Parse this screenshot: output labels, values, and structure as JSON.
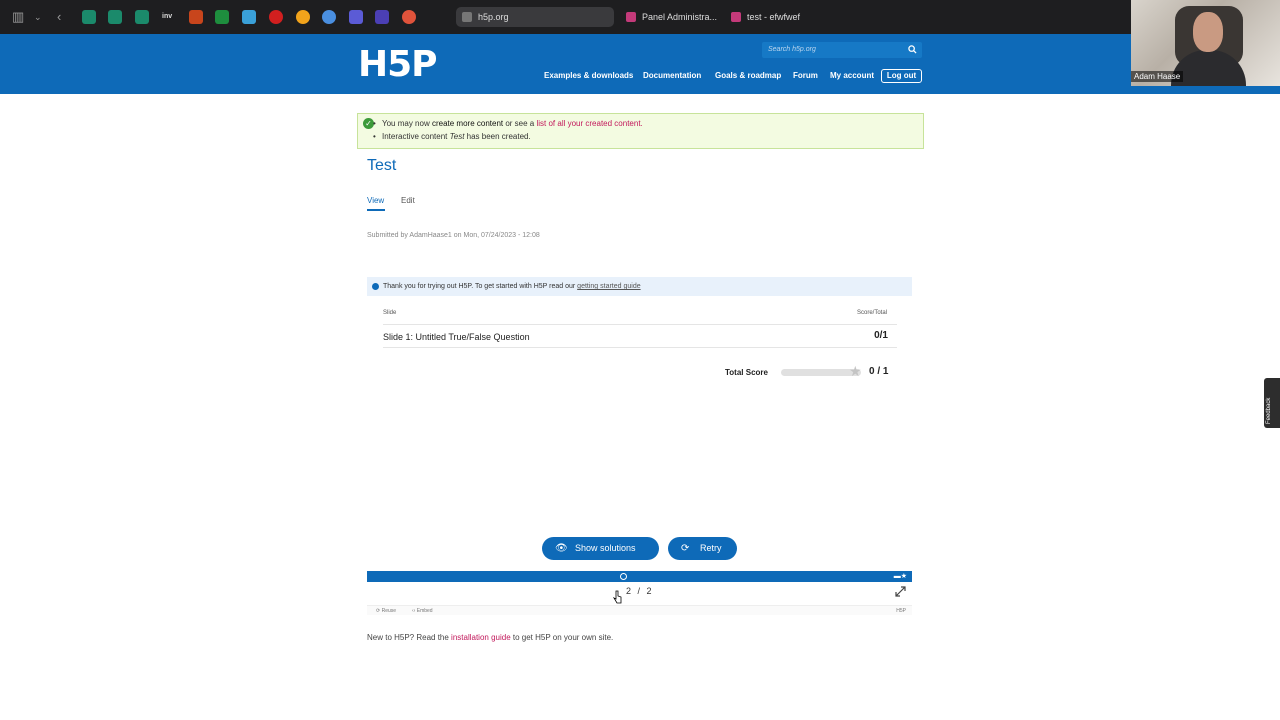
{
  "browser": {
    "tabs": [
      {
        "label": "h5p.org",
        "active": true
      },
      {
        "label": "Panel Administra...",
        "active": false
      },
      {
        "label": "test - efwfwef",
        "active": false
      }
    ],
    "bookmark_label_inv": "inv"
  },
  "header": {
    "logo": "H5P",
    "search_placeholder": "Search h5p.org",
    "nav": [
      "Examples & downloads",
      "Documentation",
      "Goals & roadmap",
      "Forum",
      "My account"
    ],
    "logout_label": "Log out"
  },
  "webcam": {
    "name": "Adam Haase"
  },
  "messages": {
    "line1_prefix": "You may now ",
    "line1_bold": "create more content",
    "line1_middle": " or see a ",
    "line1_link": "list of all your created content.",
    "line2_prefix": "Interactive content ",
    "line2_italic": "Test",
    "line2_suffix": " has been created."
  },
  "page": {
    "title": "Test",
    "tab_view": "View",
    "tab_edit": "Edit",
    "submitted": "Submitted by AdamHaase1 on Mon, 07/24/2023 - 12:08"
  },
  "h5p": {
    "info_text": "Thank you for trying out H5P. To get started with H5P read our ",
    "info_link": "getting started guide",
    "col_slide": "Slide",
    "col_score": "Score/Total",
    "rows": [
      {
        "slide": "Slide 1: Untitled True/False Question",
        "score": "0/1"
      }
    ],
    "total_label": "Total Score",
    "total_value": "0 / 1",
    "total_fraction": 0,
    "show_solutions": "Show solutions",
    "retry": "Retry",
    "pager": "2 / 2",
    "reuse": "Reuse",
    "embed": "Embed",
    "h5p_mark": "H5P"
  },
  "bottom": {
    "prefix": "New to H5P? Read the ",
    "link": "installation guide",
    "suffix": " to get H5P on your own site."
  },
  "feedback_label": "Feedback",
  "colors": {
    "brand_blue": "#0e6ab8",
    "link_pink": "#c2185b",
    "success_bg": "#f3fbe1"
  }
}
